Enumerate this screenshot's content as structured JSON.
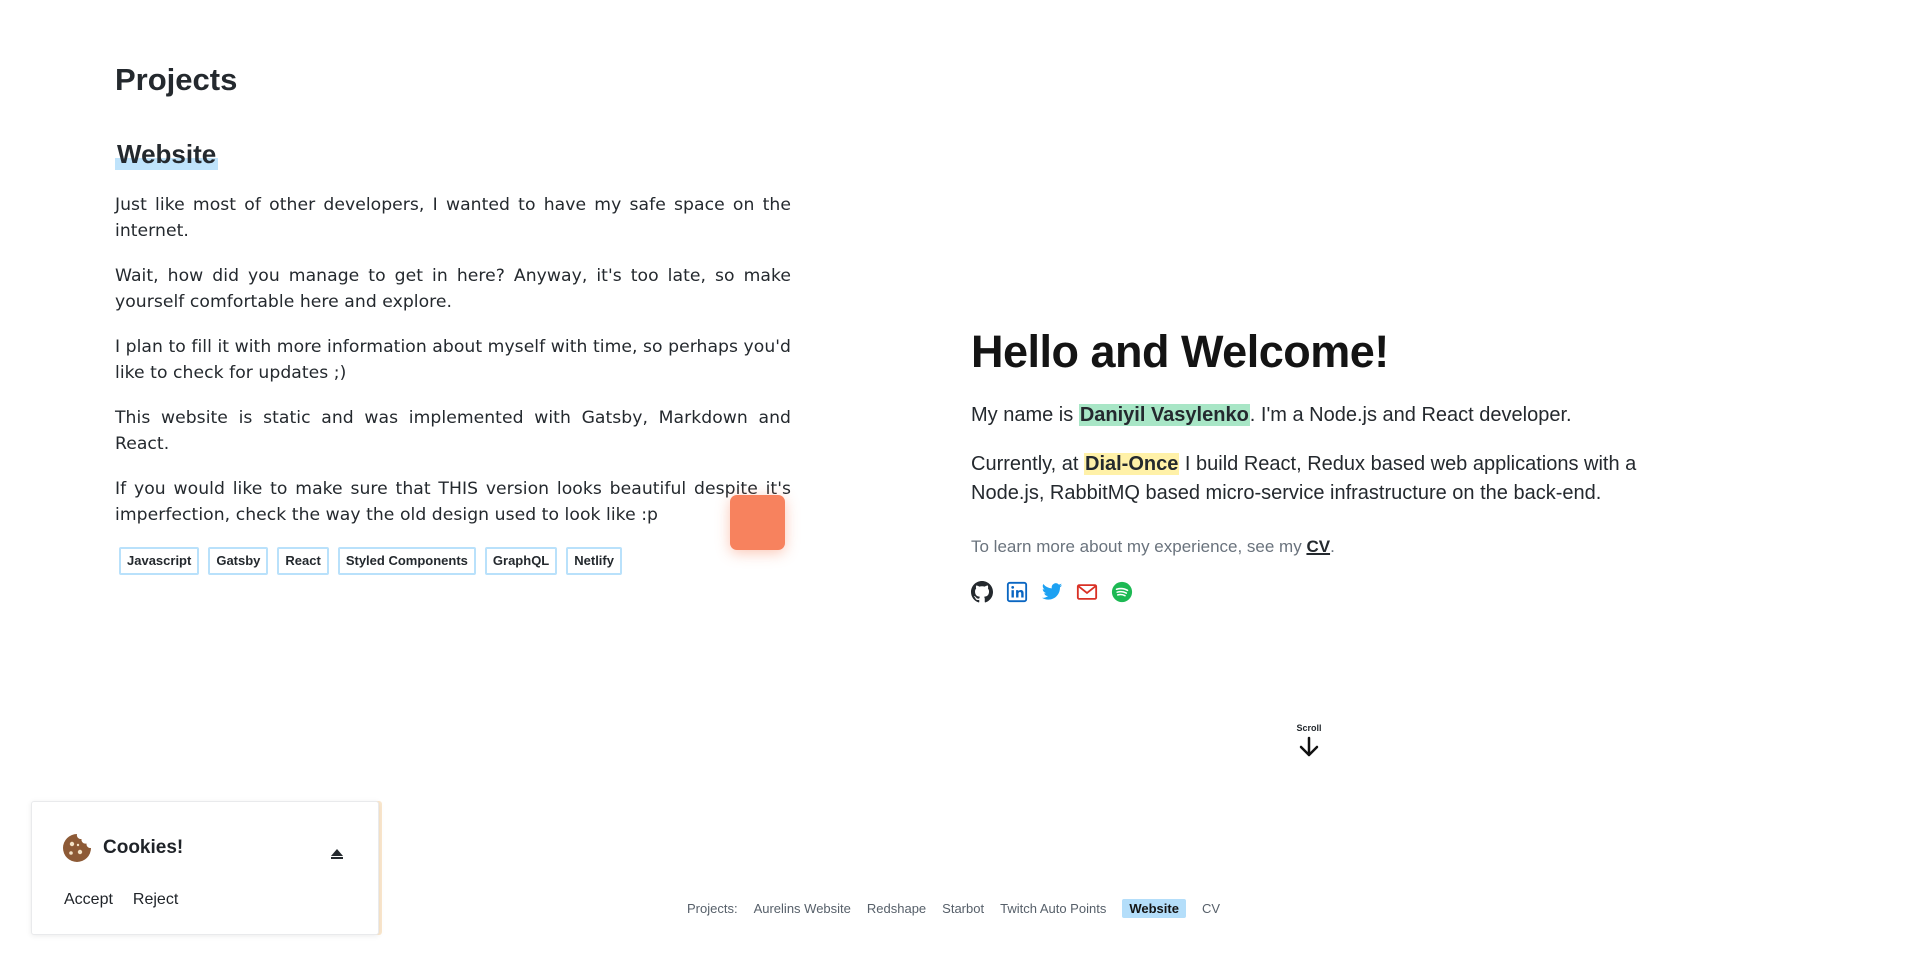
{
  "projects": {
    "heading": "Projects",
    "current": {
      "title": "Website",
      "paragraphs": [
        "Just like most of other developers, I wanted to have my safe space on the internet.",
        "Wait, how did you manage to get in here? Anyway, it's too late, so make yourself comfortable here and explore.",
        "I plan to fill it with more information about myself with time, so perhaps you'd like to check for updates ;)",
        "This website is static and was implemented with Gatsby, Markdown and React.",
        "If you would like to make sure that THIS version looks beautiful despite it's imperfection, check the way the old design used to look like :p"
      ],
      "tags": [
        "Javascript",
        "Gatsby",
        "React",
        "Styled Components",
        "GraphQL",
        "Netlify"
      ]
    }
  },
  "intro": {
    "title": "Hello and Welcome!",
    "p1_before": "My name is ",
    "name": "Daniyil Vasylenko",
    "p1_after": ". I'm a Node.js and React developer.",
    "p2_before": "Currently, at ",
    "company": "Dial-Once",
    "p2_after": " I build React, Redux based web applications with a Node.js, RabbitMQ based micro-service infrastructure on the back-end.",
    "p3_before": "To learn more about my experience, see my ",
    "cv_link": "CV",
    "p3_after": ".",
    "socials": [
      {
        "icon": "github-icon",
        "color": "#24292e"
      },
      {
        "icon": "linkedin-icon",
        "color": "#0a66c2"
      },
      {
        "icon": "twitter-icon",
        "color": "#1da1f2"
      },
      {
        "icon": "mail-icon",
        "color": "#d93025"
      },
      {
        "icon": "spotify-icon",
        "color": "#1db954"
      }
    ]
  },
  "scroll": {
    "label": "Scroll"
  },
  "footer": {
    "label": "Projects:",
    "links": [
      "Aurelins Website",
      "Redshape",
      "Starbot",
      "Twitch Auto Points",
      "Website",
      "CV"
    ],
    "active": "Website"
  },
  "cookies": {
    "title": "Cookies!",
    "accept": "Accept",
    "reject": "Reject"
  },
  "colors": {
    "accent_orange": "#f7825e",
    "highlight_blue": "#b4defa",
    "highlight_green": "#a8e6c6",
    "highlight_yellow": "#fff1a8"
  }
}
